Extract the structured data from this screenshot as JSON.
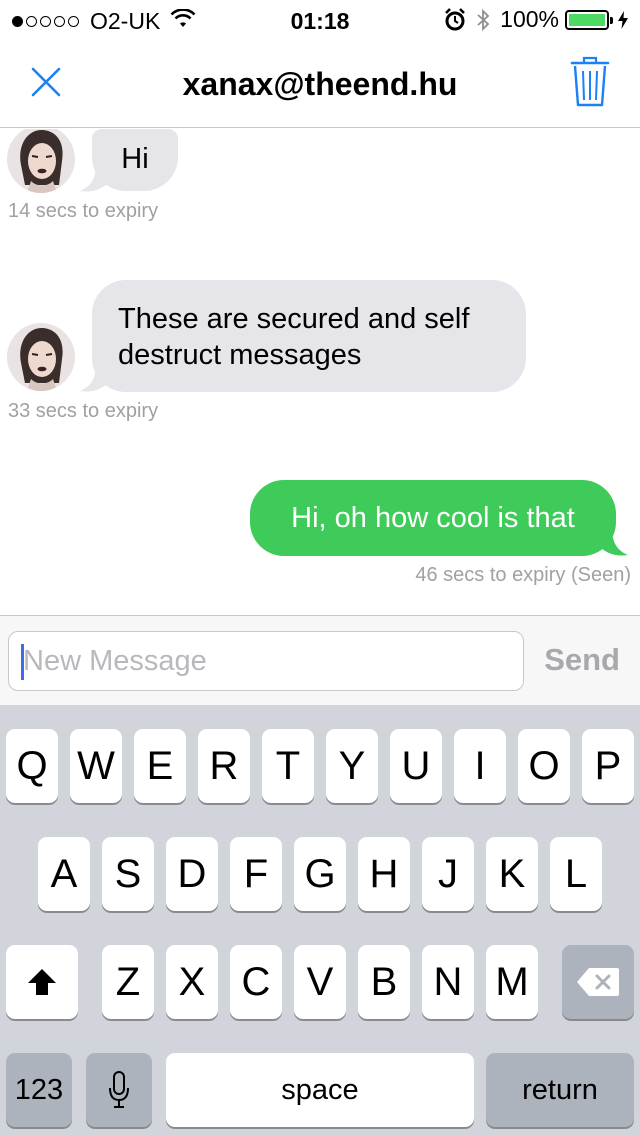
{
  "status_bar": {
    "carrier": "O2-UK",
    "time": "01:18",
    "battery": "100%",
    "signal_bars_filled": 1,
    "signal_bars_total": 5,
    "icons": [
      "wifi-icon",
      "alarm-icon",
      "bluetooth-icon",
      "battery-icon",
      "charging-icon"
    ]
  },
  "nav": {
    "title": "xanax@theend.hu",
    "close_icon": "close-icon",
    "trash_icon": "trash-icon",
    "accent_color": "#1a82f6"
  },
  "messages": [
    {
      "direction": "incoming",
      "text": "Hi",
      "expiry": "14 secs to expiry"
    },
    {
      "direction": "incoming",
      "text_lines": [
        "These are secured and self",
        "destruct messages"
      ],
      "expiry": "33 secs to expiry"
    },
    {
      "direction": "outgoing",
      "text": "Hi, oh how cool is that",
      "expiry": "46 secs to expiry (Seen)"
    }
  ],
  "composer": {
    "placeholder": "New Message",
    "value": "",
    "send_label": "Send"
  },
  "keyboard": {
    "row1": [
      "Q",
      "W",
      "E",
      "R",
      "T",
      "Y",
      "U",
      "I",
      "O",
      "P"
    ],
    "row2": [
      "A",
      "S",
      "D",
      "F",
      "G",
      "H",
      "J",
      "K",
      "L"
    ],
    "row3": [
      "Z",
      "X",
      "C",
      "V",
      "B",
      "N",
      "M"
    ],
    "numbers_label": "123",
    "space_label": "space",
    "return_label": "return",
    "shift_icon": "shift-icon",
    "delete_icon": "delete-icon",
    "mic_icon": "microphone-icon"
  },
  "colors": {
    "incoming_bubble": "#e5e5ea",
    "outgoing_bubble": "#3fcb5a",
    "expiry_text": "#a0a0a5",
    "battery_fill": "#4cd964"
  }
}
